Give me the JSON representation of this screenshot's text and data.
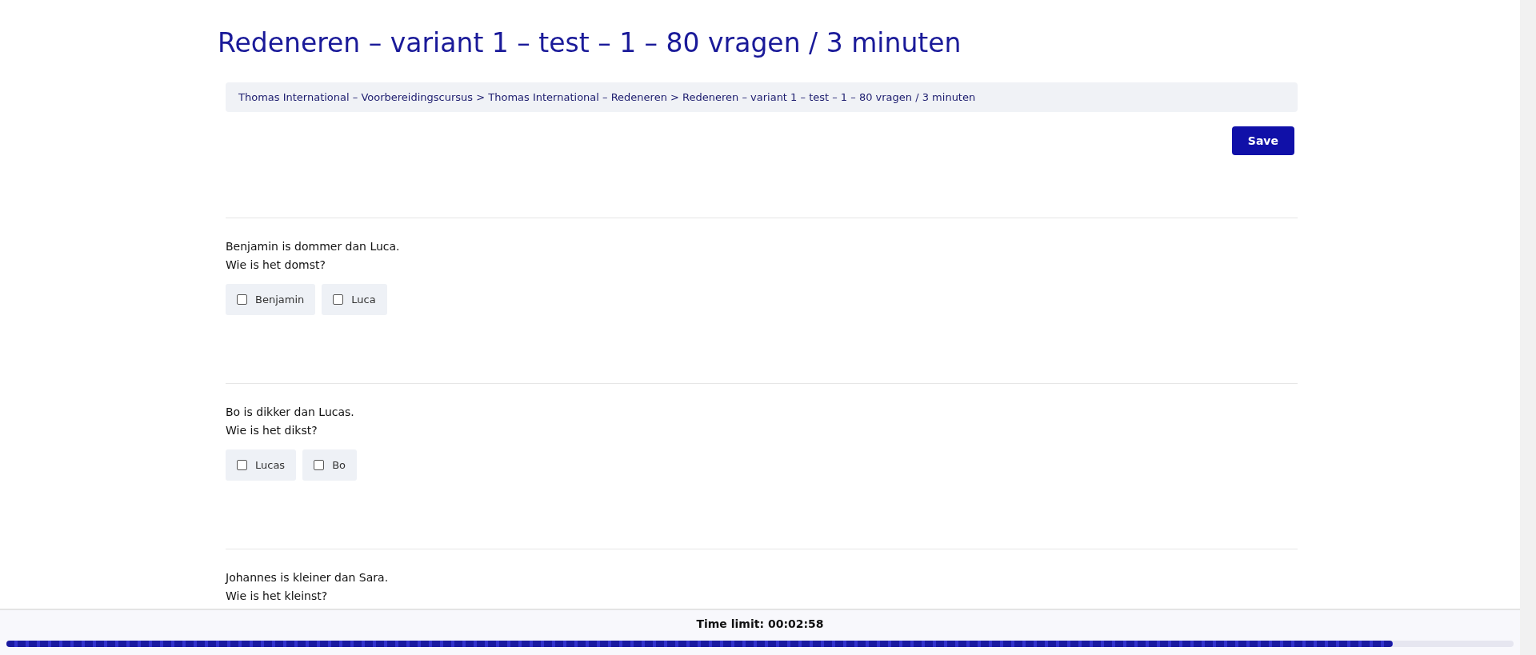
{
  "title": "Redeneren – variant 1 – test – 1 – 80 vragen / 3 minuten",
  "breadcrumb": "Thomas International – Voorbereidingscursus > Thomas International – Redeneren > Redeneren – variant 1 – test – 1 – 80 vragen / 3 minuten",
  "save_button": "Save",
  "questions": [
    {
      "lines": [
        "Benjamin is dommer dan Luca.",
        "Wie is het domst?"
      ],
      "options": [
        {
          "label": "Benjamin",
          "checked": false
        },
        {
          "label": "Luca",
          "checked": false
        }
      ]
    },
    {
      "lines": [
        "Bo is dikker dan Lucas.",
        "Wie is het dikst?"
      ],
      "options": [
        {
          "label": "Lucas",
          "checked": false
        },
        {
          "label": "Bo",
          "checked": false
        }
      ]
    },
    {
      "lines": [
        "Johannes is kleiner dan Sara.",
        "Wie is het kleinst?"
      ]
    }
  ],
  "timer": {
    "label": "Time limit: 00:02:58",
    "level": 0.92
  }
}
